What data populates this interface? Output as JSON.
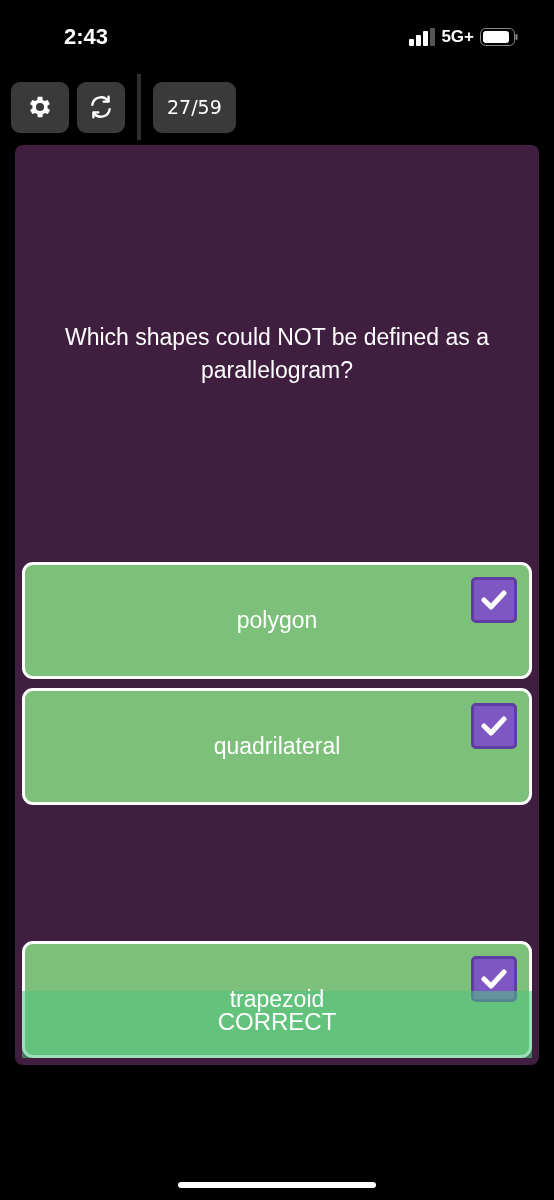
{
  "status_bar": {
    "time": "2:43",
    "network": "5G+"
  },
  "toolbar": {
    "counter": "27/59"
  },
  "question": "Which shapes could NOT be defined as a parallelogram?",
  "options": [
    {
      "label": "polygon",
      "checked": true
    },
    {
      "label": "quadrilateral",
      "checked": true
    },
    {
      "label": "trapezoid",
      "checked": true
    }
  ],
  "result": {
    "label": "CORRECT"
  }
}
